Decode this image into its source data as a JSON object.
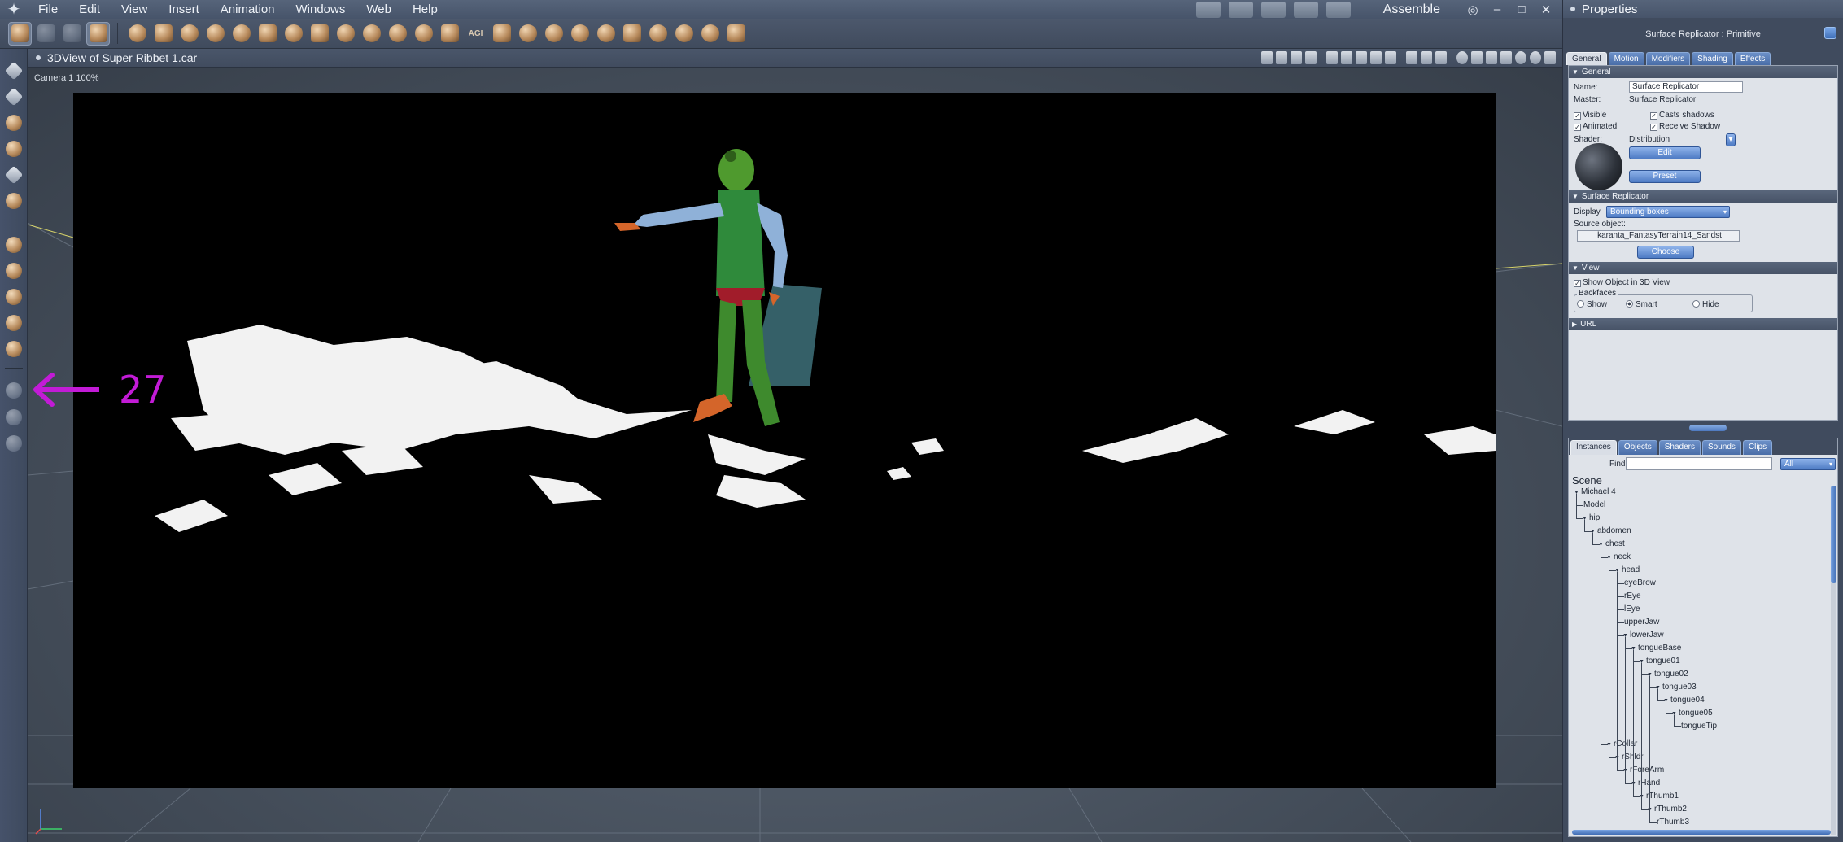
{
  "menubar": {
    "items": [
      "File",
      "Edit",
      "View",
      "Insert",
      "Animation",
      "Windows",
      "Web",
      "Help"
    ],
    "room": "Assemble",
    "window_controls": [
      "◎",
      "–",
      "□",
      "✕"
    ]
  },
  "toolbar": {
    "agi_label": "AGI"
  },
  "view": {
    "title": "3DView of Super Ribbet 1.car",
    "camera_label": "Camera 1 100%"
  },
  "annotation": {
    "number": "27",
    "color": "#c21bd6"
  },
  "properties": {
    "panel_title": "Properties",
    "object_type": "Surface Replicator : Primitive",
    "tabs": [
      "General",
      "Motion",
      "Modifiers",
      "Shading",
      "Effects"
    ],
    "general": {
      "section": "General",
      "name_label": "Name:",
      "name_value": "Surface Replicator",
      "master_label": "Master:",
      "master_value": "Surface Replicator",
      "visible": "Visible",
      "animated": "Animated",
      "casts_shadows": "Casts shadows",
      "receive_shadow": "Receive Shadow",
      "shader_label": "Shader:",
      "shader_value": "Distribution",
      "edit_button": "Edit",
      "preset_button": "Preset"
    },
    "surface_replicator": {
      "section": "Surface Replicator",
      "display_label": "Display",
      "display_value": "Bounding boxes",
      "source_label": "Source object:",
      "source_value": "karanta_FantasyTerrain14_Sandst",
      "choose_button": "Choose"
    },
    "view_section": {
      "section": "View",
      "show_in_3d": "Show Object in 3D View",
      "backfaces_label": "Backfaces",
      "options": [
        "Show",
        "Smart",
        "Hide"
      ]
    },
    "url_section": "URL"
  },
  "browser": {
    "tabs": [
      "Instances",
      "Objects",
      "Shaders",
      "Sounds",
      "Clips"
    ],
    "find_label": "Find:",
    "filter_value": "All",
    "scene_label": "Scene",
    "nodes": [
      {
        "label": "Michael 4",
        "depth": 0,
        "open": true
      },
      {
        "label": "Model",
        "depth": 1,
        "open": false
      },
      {
        "label": "hip",
        "depth": 1,
        "open": true
      },
      {
        "label": "abdomen",
        "depth": 2,
        "open": true
      },
      {
        "label": "chest",
        "depth": 3,
        "open": true
      },
      {
        "label": "neck",
        "depth": 4,
        "open": true
      },
      {
        "label": "head",
        "depth": 5,
        "open": true
      },
      {
        "label": "eyeBrow",
        "depth": 6,
        "open": false
      },
      {
        "label": "rEye",
        "depth": 6,
        "open": false
      },
      {
        "label": "lEye",
        "depth": 6,
        "open": false
      },
      {
        "label": "upperJaw",
        "depth": 6,
        "open": false
      },
      {
        "label": "lowerJaw",
        "depth": 6,
        "open": true
      },
      {
        "label": "tongueBase",
        "depth": 7,
        "open": true
      },
      {
        "label": "tongue01",
        "depth": 8,
        "open": true
      },
      {
        "label": "tongue02",
        "depth": 9,
        "open": true
      },
      {
        "label": "tongue03",
        "depth": 10,
        "open": true
      },
      {
        "label": "tongue04",
        "depth": 11,
        "open": true
      },
      {
        "label": "tongue05",
        "depth": 12,
        "open": true
      },
      {
        "label": "tongueTip",
        "depth": 13,
        "open": false
      },
      {
        "label": "rCollar",
        "depth": 4,
        "open": true
      },
      {
        "label": "rShldr",
        "depth": 5,
        "open": true
      },
      {
        "label": "rForeArm",
        "depth": 6,
        "open": true
      },
      {
        "label": "rHand",
        "depth": 7,
        "open": true
      },
      {
        "label": "rThumb1",
        "depth": 8,
        "open": true
      },
      {
        "label": "rThumb2",
        "depth": 9,
        "open": true
      },
      {
        "label": "rThumb3",
        "depth": 10,
        "open": false
      }
    ]
  }
}
